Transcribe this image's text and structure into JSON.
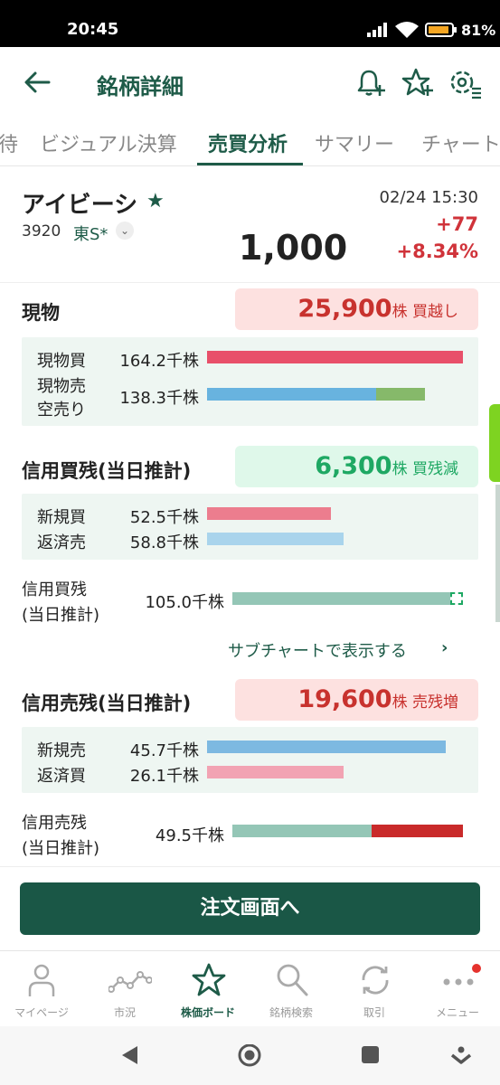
{
  "status": {
    "time": "20:45",
    "battery": "81%"
  },
  "appbar": {
    "title": "銘柄詳細"
  },
  "tabs": [
    {
      "label": "待"
    },
    {
      "label": "ビジュアル決算"
    },
    {
      "label": "売買分析"
    },
    {
      "label": "サマリー"
    },
    {
      "label": "チャート"
    }
  ],
  "stock": {
    "name": "アイビーシ",
    "code": "3920",
    "market": "東S*",
    "datetime": "02/24 15:30",
    "change": "+77",
    "change_pct": "+8.34%",
    "price": "1,000"
  },
  "genbutsu": {
    "title": "現物",
    "badge_num": "25,900",
    "badge_unit": "株 買越し",
    "rows": [
      {
        "label": "現物買",
        "value": "164.2千株"
      },
      {
        "label": "現物売",
        "label2": "空売り",
        "value": "138.3千株"
      }
    ]
  },
  "margin_buy": {
    "title": "信用買残(当日推計)",
    "badge_num": "6,300",
    "badge_unit": "株 買残減",
    "rows": [
      {
        "label": "新規買",
        "value": "52.5千株"
      },
      {
        "label": "返済売",
        "value": "58.8千株"
      }
    ],
    "balance": {
      "label": "信用買残",
      "label2": "(当日推計)",
      "value": "105.0千株"
    }
  },
  "subchart_link": "サブチャートで表示する",
  "margin_sell": {
    "title": "信用売残(当日推計)",
    "badge_num": "19,600",
    "badge_unit": "株 売残増",
    "rows": [
      {
        "label": "新規売",
        "value": "45.7千株"
      },
      {
        "label": "返済買",
        "value": "26.1千株"
      }
    ],
    "balance": {
      "label": "信用売残",
      "label2": "(当日推計)",
      "value": "49.5千株"
    }
  },
  "order_button": "注文画面へ",
  "bottom_nav": [
    {
      "label": "マイページ"
    },
    {
      "label": "市況"
    },
    {
      "label": "株価ボード"
    },
    {
      "label": "銘柄検索"
    },
    {
      "label": "取引"
    },
    {
      "label": "メニュー"
    }
  ],
  "colors": {
    "brand": "#1e5b48",
    "up": "#d0333a",
    "buy_bar": "#e8506a",
    "sell_bar": "#68b3df",
    "short_bar": "#86b96a",
    "balance_bar": "#94c6b6",
    "increase_bar": "#c92a2a"
  }
}
